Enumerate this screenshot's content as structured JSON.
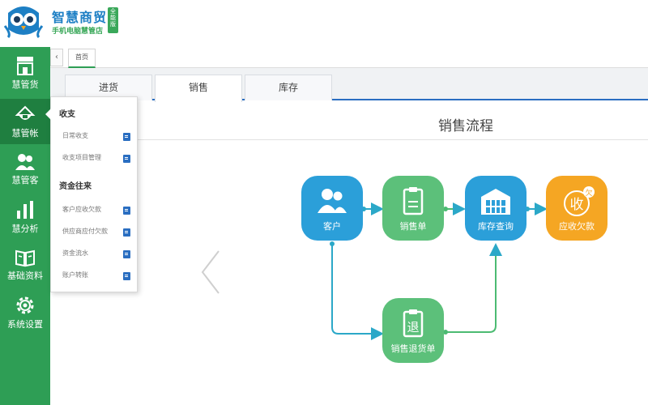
{
  "brand": {
    "name": "智慧商贸",
    "badge": "全能版",
    "slogan": "手机电脑慧管店"
  },
  "sidebar": {
    "items": [
      {
        "label": "慧管货",
        "icon": "store-icon"
      },
      {
        "label": "慧管帐",
        "icon": "money-bag-icon"
      },
      {
        "label": "慧管客",
        "icon": "users-icon"
      },
      {
        "label": "慧分析",
        "icon": "bar-chart-icon"
      },
      {
        "label": "基础资料",
        "icon": "book-icon"
      },
      {
        "label": "系统设置",
        "icon": "gear-icon"
      }
    ]
  },
  "popup": {
    "groups": [
      {
        "title": "收支",
        "items": [
          "日常收支",
          "收支项目管理"
        ]
      },
      {
        "title": "资金往来",
        "items": [
          "客户应收欠款",
          "供应商应付欠款",
          "资金流水",
          "账户转账"
        ]
      }
    ]
  },
  "pagebar": {
    "collapse_symbol": "‹",
    "tab": "首页"
  },
  "subtabs": [
    "进货",
    "销售",
    "库存"
  ],
  "content": {
    "title": "销售流程"
  },
  "flow": {
    "nodes": [
      {
        "label": "客户",
        "color": "#2b9fd9",
        "icon": "users-icon"
      },
      {
        "label": "销售单",
        "color": "#5cc07a",
        "icon": "clipboard-icon"
      },
      {
        "label": "库存查询",
        "color": "#2b9fd9",
        "icon": "warehouse-icon"
      },
      {
        "label": "应收欠款",
        "color": "#f5a623",
        "icon": "receivable-icon",
        "glyph_main": "收",
        "glyph_sub": "欠"
      },
      {
        "label": "销售退货单",
        "color": "#5cc07a",
        "icon": "return-clipboard-icon",
        "glyph": "退"
      }
    ]
  },
  "colors": {
    "sidebar_green": "#2e9e55",
    "sidebar_active": "#1f7f40",
    "accent_blue": "#2a6ec1",
    "brand_blue": "#1d7fc4",
    "brand_green": "#3aa85a"
  }
}
